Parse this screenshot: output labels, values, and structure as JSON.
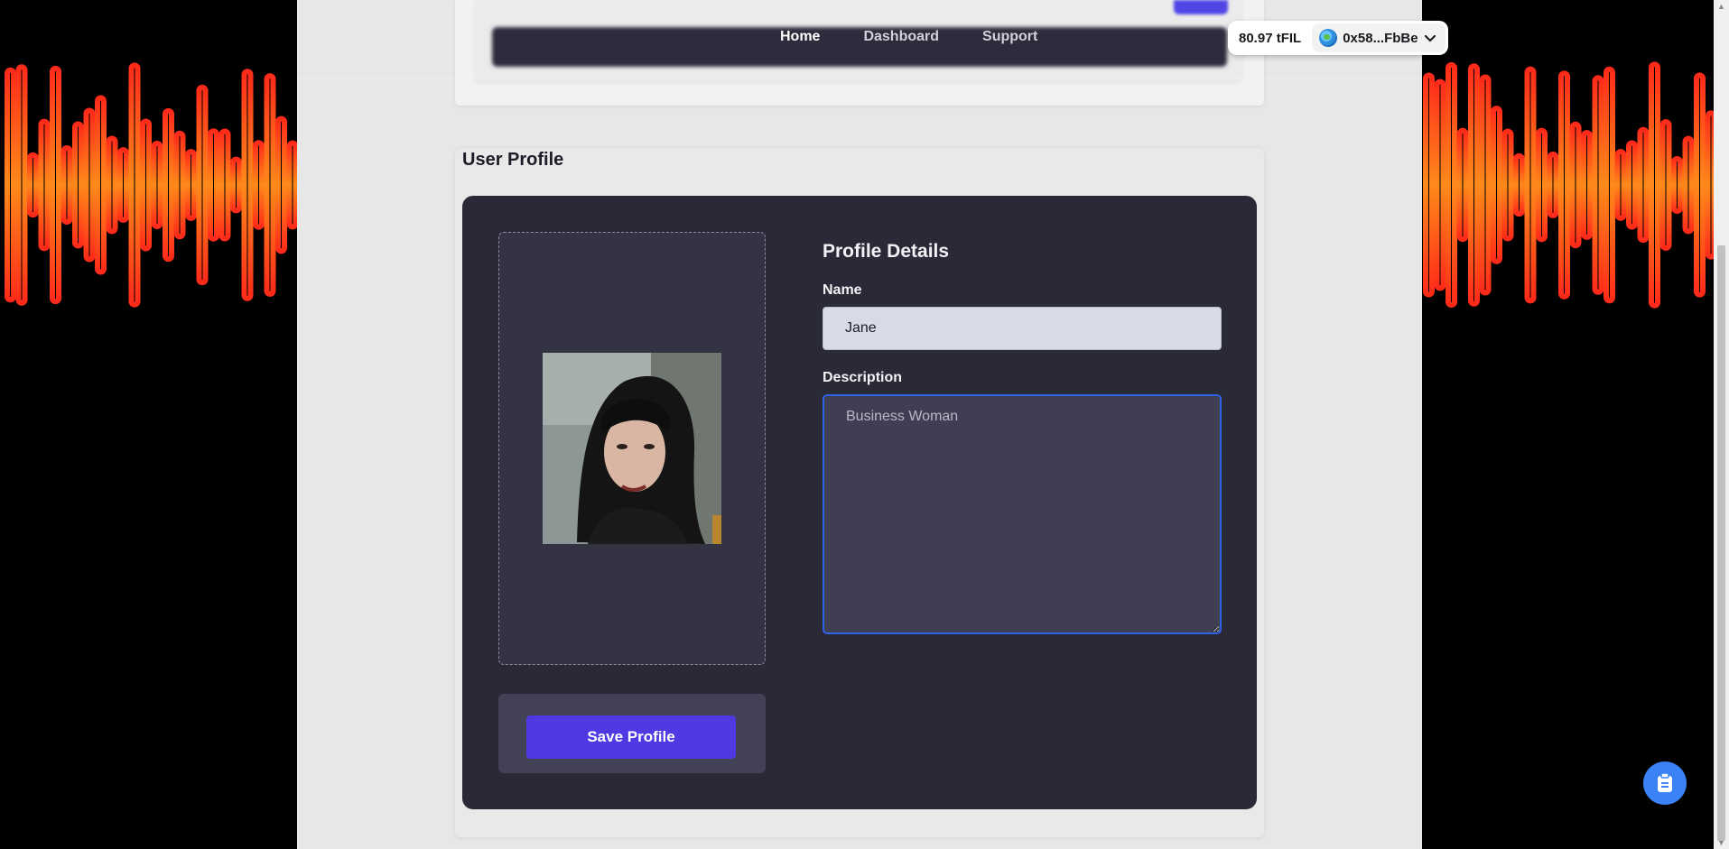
{
  "nav": {
    "links": [
      {
        "label": "Home",
        "active": true
      },
      {
        "label": "Dashboard",
        "active": false
      },
      {
        "label": "Support",
        "active": false
      }
    ]
  },
  "wallet": {
    "balance": "80.97 tFIL",
    "account": "0x58...FbBe",
    "icons": {
      "network": "globe-icon",
      "expand": "chevron-down-icon"
    }
  },
  "profile": {
    "section_title": "User Profile",
    "details_title": "Profile Details",
    "name_label": "Name",
    "name_value": "Jane",
    "description_label": "Description",
    "description_value": "Business Woman",
    "save_label": "Save Profile",
    "avatar": "profile-photo"
  },
  "chat": {
    "icon": "clipboard-chat-icon"
  },
  "colors": {
    "accent": "#4f39e3",
    "card_bg": "#2a2937",
    "focus_border": "#2f63e6",
    "wave_red": "#ff2a1a",
    "wave_orange": "#ff7a1a"
  }
}
